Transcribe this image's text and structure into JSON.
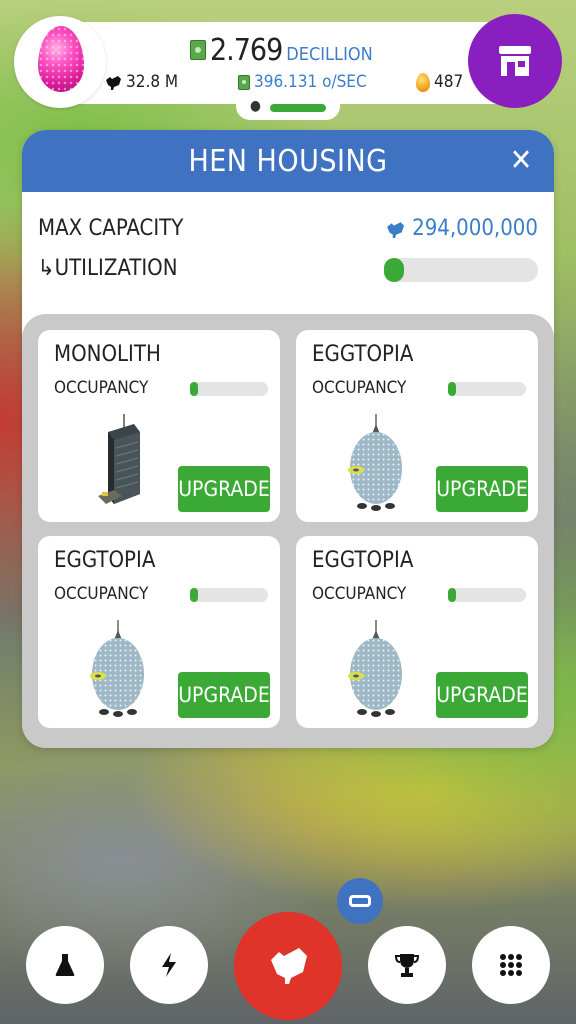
{
  "top_bar": {
    "money_value": "2.769",
    "money_unit": "DECILLION",
    "chickens": "32.8 M",
    "earning_rate": "396.131 o/SEC",
    "golden_eggs": "487",
    "hab_fill": 1.0
  },
  "panel": {
    "title": "HEN HOUSING",
    "max_capacity_label": "MAX CAPACITY",
    "max_capacity_value": "294,000,000",
    "utilization_label": "↳UTILIZATION",
    "utilization_fraction": 0.11
  },
  "habs": [
    {
      "name": "MONOLITH",
      "occupancy_label": "OCCUPANCY",
      "occupancy_fraction": 0.05,
      "button": "UPGRADE",
      "kind": "monolith"
    },
    {
      "name": "EGGTOPIA",
      "occupancy_label": "OCCUPANCY",
      "occupancy_fraction": 0.1,
      "button": "UPGRADE",
      "kind": "eggtopia"
    },
    {
      "name": "EGGTOPIA",
      "occupancy_label": "OCCUPANCY",
      "occupancy_fraction": 0.1,
      "button": "UPGRADE",
      "kind": "eggtopia"
    },
    {
      "name": "EGGTOPIA",
      "occupancy_label": "OCCUPANCY",
      "occupancy_fraction": 0.1,
      "button": "UPGRADE",
      "kind": "eggtopia"
    }
  ],
  "icons": {
    "shop": "shop-icon",
    "close": "close-icon",
    "research": "flask-icon",
    "boost": "lightning-icon",
    "main": "chicken-icon",
    "trophy": "trophy-icon",
    "menu": "grid-menu-icon"
  },
  "colors": {
    "header_blue": "#3f73c2",
    "upgrade_green": "#3aa935",
    "shop_purple": "#8a1fbf",
    "main_red": "#e0332a",
    "value_blue": "#3a7ec9"
  }
}
